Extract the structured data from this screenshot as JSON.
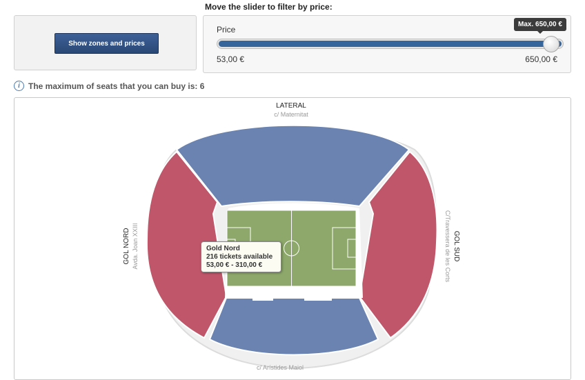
{
  "slider": {
    "title": "Move the slider to filter by price:",
    "price_label": "Price",
    "min_label": "53,00 €",
    "max_label": "650,00 €",
    "max_tooltip": "Max. 650,00 €",
    "selected_fraction": 1.0
  },
  "zones_button": {
    "label": "Show zones and prices"
  },
  "info": {
    "text": "The maximum of seats that you can buy is: 6"
  },
  "map": {
    "top_name": "LATERAL",
    "top_street": "c/ Maternitat",
    "left_name": "GOL NORD",
    "left_street": "Avda. Joan XXIII",
    "right_name": "GOL SUD",
    "right_street": "C/Travessera de les Corts",
    "bottom_street": "c/ Arístides Maiol"
  },
  "tooltip": {
    "zone": "Gold Nord",
    "tickets": "216 tickets available",
    "price_range": "53,00 € - 310,00 €"
  },
  "colors": {
    "lateral_blue": "#6b83b1",
    "gol_red": "#c0566a",
    "pitch_green": "#8da86a",
    "button_blue": "#35659b"
  }
}
